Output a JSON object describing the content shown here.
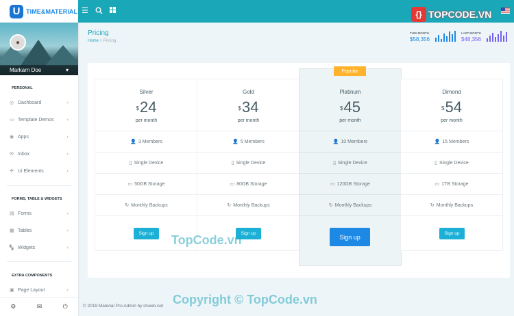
{
  "brand": {
    "logo_letter": "U",
    "name": "TIME&MATERIAL"
  },
  "topbar": {
    "menu_icon": "menu-icon",
    "search_icon": "search-icon",
    "apps_icon": "grid-icon",
    "ad_logo_symbol": "{}",
    "ad_text": "TOPCODE.VN",
    "flag": "us-flag-icon"
  },
  "sidebar": {
    "user_name": "Markarn Doe",
    "sections": [
      {
        "title": "PERSONAL",
        "items": [
          {
            "label": "Dashboard",
            "icon": "gauge-icon"
          },
          {
            "label": "Template Demos",
            "icon": "laptop-icon"
          },
          {
            "label": "Apps",
            "icon": "target-icon"
          },
          {
            "label": "Inbox",
            "icon": "mail-icon"
          },
          {
            "label": "Ui Elements",
            "icon": "bubbles-icon"
          }
        ]
      },
      {
        "title": "FORMS, TABLE & WIDGETS",
        "items": [
          {
            "label": "Forms",
            "icon": "form-icon"
          },
          {
            "label": "Tables",
            "icon": "table-icon"
          },
          {
            "label": "Widgets",
            "icon": "widgets-icon"
          }
        ]
      },
      {
        "title": "EXTRA COMPONENTS",
        "items": [
          {
            "label": "Page Layout",
            "icon": "layout-icon"
          }
        ]
      }
    ],
    "footer_icons": [
      "settings-icon",
      "mail-icon",
      "power-icon"
    ]
  },
  "page": {
    "title": "Pricing",
    "breadcrumb": {
      "home": "Home",
      "separator": ">",
      "current": "Pricing"
    },
    "stats": [
      {
        "label": "THIS MONTH",
        "value": "$58,356",
        "color": "#1e88e5"
      },
      {
        "label": "LAST MONTH",
        "value": "$48,356",
        "color": "#7460ee"
      }
    ]
  },
  "plans": [
    {
      "name": "Silver",
      "currency": "$",
      "price": "24",
      "period": "per month",
      "members": "3 Members",
      "device": "Single Device",
      "storage": "50GB Storage",
      "backup": "Monthly Backups",
      "cta": "Sign up",
      "featured": false
    },
    {
      "name": "Gold",
      "currency": "$",
      "price": "34",
      "period": "per month",
      "members": "5 Members",
      "device": "Single Device",
      "storage": "80GB Storage",
      "backup": "Monthly Backups",
      "cta": "Sign up",
      "featured": false
    },
    {
      "name": "Platinum",
      "currency": "$",
      "price": "45",
      "period": "per month",
      "members": "10 Members",
      "device": "Single Device",
      "storage": "120GB Storage",
      "backup": "Monthly Backups",
      "cta": "Sign up",
      "featured": true,
      "badge": "Popular"
    },
    {
      "name": "Dimond",
      "currency": "$",
      "price": "54",
      "period": "per month",
      "members": "15 Members",
      "device": "Single Device",
      "storage": "1TB Storage",
      "backup": "Monthly Backups",
      "cta": "Sign up",
      "featured": false
    }
  ],
  "footer": {
    "text": "© 2019 Material Pro Admin by iziweb.net"
  },
  "watermarks": {
    "center": "TopCode.vn",
    "bottom": "Copyright © TopCode.vn"
  }
}
